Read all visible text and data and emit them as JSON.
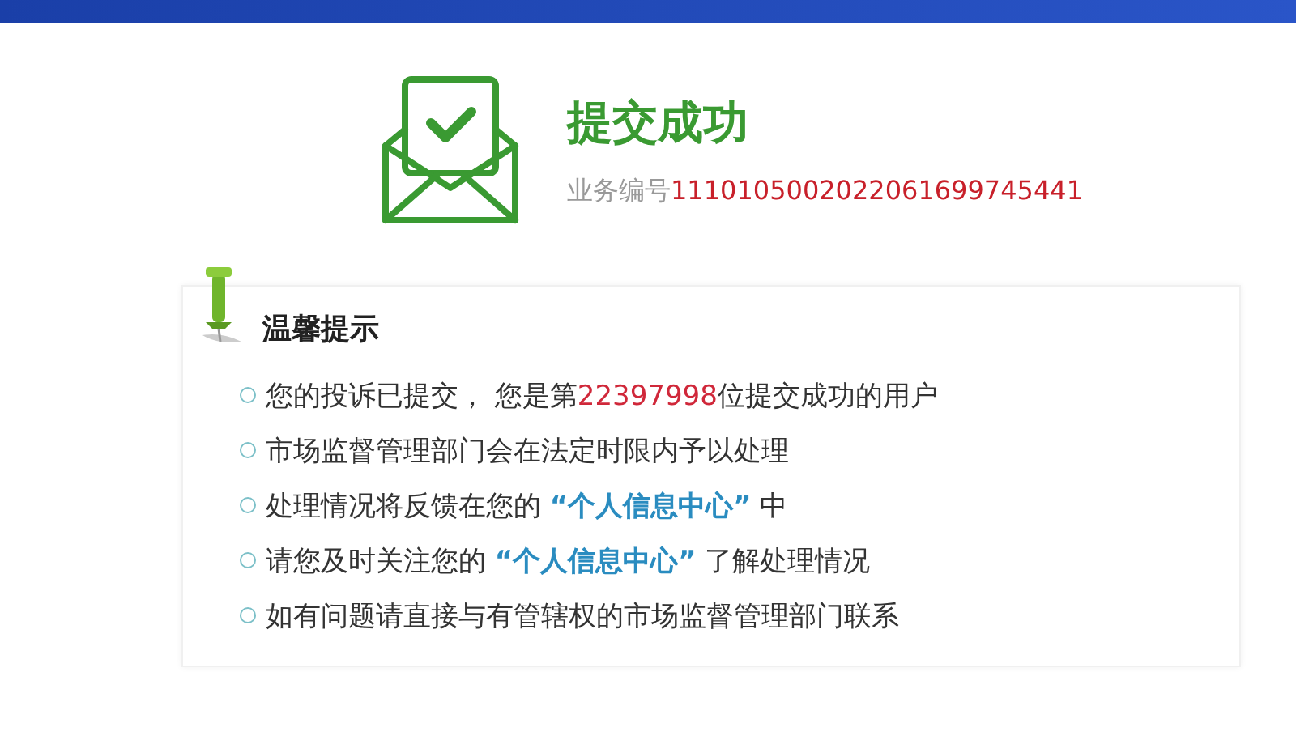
{
  "title": "提交成功",
  "business_number": {
    "label": "业务编号",
    "value": "1110105002022061699745441"
  },
  "tips": {
    "heading": "温馨提示",
    "items": [
      {
        "segments": [
          {
            "kind": "plain",
            "text": "您的投诉已提交， 您是第"
          },
          {
            "kind": "number",
            "text": "22397998"
          },
          {
            "kind": "plain",
            "text": "位提交成功的用户"
          }
        ]
      },
      {
        "segments": [
          {
            "kind": "plain",
            "text": "市场监督管理部门会在法定时限内予以处理"
          }
        ]
      },
      {
        "segments": [
          {
            "kind": "plain",
            "text": "处理情况将反馈在您的 "
          },
          {
            "kind": "highlight",
            "text": "“个人信息中心”"
          },
          {
            "kind": "plain",
            "text": " 中"
          }
        ]
      },
      {
        "segments": [
          {
            "kind": "plain",
            "text": "请您及时关注您的 "
          },
          {
            "kind": "highlight",
            "text": "“个人信息中心”"
          },
          {
            "kind": "plain",
            "text": " 了解处理情况"
          }
        ]
      },
      {
        "segments": [
          {
            "kind": "plain",
            "text": "如有问题请直接与有管辖权的市场监督管理部门联系"
          }
        ]
      }
    ]
  }
}
